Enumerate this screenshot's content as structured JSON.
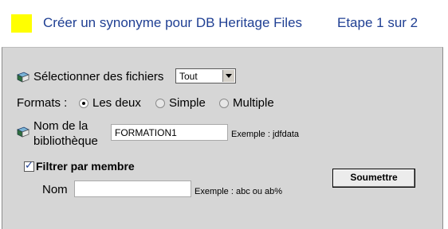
{
  "header": {
    "title": "Créer un synonyme pour DB Heritage Files",
    "step": "Etape 1 sur 2"
  },
  "files": {
    "label": "Sélectionner des fichiers",
    "select_value": "Tout"
  },
  "formats": {
    "label": "Formats :",
    "options": [
      "Les deux",
      "Simple",
      "Multiple"
    ],
    "selected": "Les deux"
  },
  "library": {
    "label_line1": "Nom de la",
    "label_line2": "bibliothèque",
    "value": "FORMATION1",
    "example": "Exemple : jdfdata"
  },
  "filter": {
    "label": "Filtrer par membre",
    "checked": true,
    "name_label": "Nom",
    "name_value": "",
    "example": "Exemple : abc ou ab%"
  },
  "submit_label": "Soumettre",
  "icons": {
    "book": "book-icon"
  }
}
